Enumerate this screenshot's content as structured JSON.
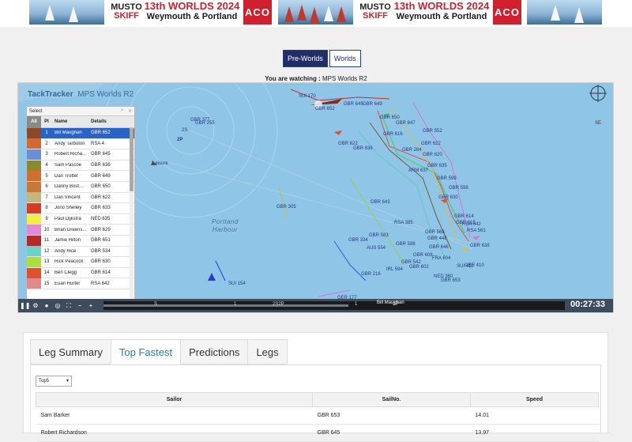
{
  "banner": {
    "logo_top": "MUSTO",
    "logo_bottom": "SKIFF",
    "title": "13th WORLDS 2024",
    "subtitle": "Weymouth & Portland",
    "sponsor": "ACO"
  },
  "view_buttons": [
    "Pre-Worlds",
    "Worlds"
  ],
  "watching": {
    "label": "You are watching :",
    "race": "MPS Worlds R2"
  },
  "map": {
    "brand": "TackTracker",
    "race_title": "MPS Worlds R2",
    "harbour_line1": "Portland",
    "harbour_line2": "Harbour",
    "compass_label": "SE",
    "water_color": "#8fc6e8",
    "boat_labels": [
      "SUI 170",
      "GBR 652",
      "GBR 645",
      "GBR 649",
      "GBR 650",
      "GBR 647",
      "GBR 552",
      "GBR 616",
      "GBR 636",
      "GBR 284",
      "GBR 622",
      "GBR 620",
      "GBR 635",
      "ARM 637",
      "GBR 598",
      "GBR 630",
      "GBR 305",
      "GBR 643",
      "RSA 385",
      "GBR 614",
      "RSA 642",
      "RSA 561",
      "GBR 583",
      "GBR 588",
      "GBR 448",
      "GBR 334",
      "AUS 554",
      "GBR 646",
      "GBR 638",
      "GBR 608",
      "GBR 542",
      "FRA 604",
      "SUI 411",
      "IRL 594",
      "GBR 602",
      "GBR 410",
      "GBR 216",
      "NED 360",
      "GBR 653",
      "SUI 154",
      "GER 177",
      "GBR 255",
      "GBR 377",
      "2S",
      "2P",
      "Leisure"
    ]
  },
  "ranking": {
    "header": "Select",
    "columns": {
      "all": "All",
      "pl": "Pl",
      "name": "Name",
      "details": "Details"
    },
    "rows": [
      {
        "pl": "1",
        "name": "Bill Maughan",
        "details": "GBR 652",
        "color": "#8b4a25"
      },
      {
        "pl": "2",
        "name": "Andy Tarboton",
        "details": "RSA 4",
        "color": "#d4682e"
      },
      {
        "pl": "3",
        "name": "Robert Richa...",
        "details": "GBR 645",
        "color": "#6b8fd6"
      },
      {
        "pl": "4",
        "name": "Sam Pascoe",
        "details": "GBR 636",
        "color": "#8a8a2a"
      },
      {
        "pl": "5",
        "name": "Dan Trotter",
        "details": "GBR 649",
        "color": "#d07030"
      },
      {
        "pl": "6",
        "name": "Danny Bost...",
        "details": "GBR 650",
        "color": "#c8783a"
      },
      {
        "pl": "7",
        "name": "Dan Vincent",
        "details": "GBR 622",
        "color": "#c2b87a"
      },
      {
        "pl": "8",
        "name": "Jono Shelley",
        "details": "GBR 633",
        "color": "#d83a24"
      },
      {
        "pl": "9",
        "name": "Paul Dijkstra",
        "details": "NED 635",
        "color": "#f0f040"
      },
      {
        "pl": "10",
        "name": "Brian Greens...",
        "details": "GBR 629",
        "color": "#e08ad8"
      },
      {
        "pl": "11",
        "name": "Jamie Hilton",
        "details": "GBR 651",
        "color": "#b42a2a"
      },
      {
        "pl": "12",
        "name": "Andy Rice",
        "details": "GBR 534",
        "color": "#6ad4c8"
      },
      {
        "pl": "13",
        "name": "Rick Peacock",
        "details": "GBR 630",
        "color": "#a8e038"
      },
      {
        "pl": "14",
        "name": "Ben Clegg",
        "details": "GBR 614",
        "color": "#e0502a"
      },
      {
        "pl": "15",
        "name": "Euan Hurter",
        "details": "RSA 642",
        "color": "#e08a8a"
      }
    ]
  },
  "player": {
    "clock": "00:27:33",
    "boat": "Bill Maughan",
    "marks": [
      "S",
      "1",
      "2S2P",
      "1",
      "2P"
    ]
  },
  "tabs": [
    "Leg Summary",
    "Top Fastest",
    "Predictions",
    "Legs"
  ],
  "active_tab": "Top Fastest",
  "top_select": "Top5",
  "table": {
    "headers": [
      "Sailor",
      "SailNo.",
      "Speed"
    ],
    "rows": [
      [
        "Sam Barker",
        "GBR 653",
        "14.01"
      ],
      [
        "Robert Richardson",
        "GBR 645",
        "13.97"
      ]
    ]
  }
}
